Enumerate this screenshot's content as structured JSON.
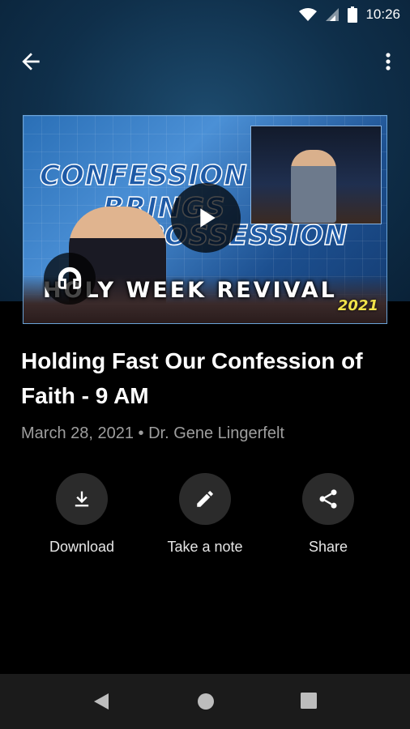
{
  "status_bar": {
    "time": "10:26"
  },
  "video": {
    "thumbnail_text": {
      "line1": "CONFESSION",
      "line2": "BRINGS",
      "line3": "POSSESSION",
      "banner": "HOLY WEEK REVIVAL",
      "year": "2021"
    }
  },
  "sermon": {
    "title": "Holding Fast Our Confession of Faith - 9 AM",
    "meta": "March 28, 2021 • Dr. Gene Lingerfelt"
  },
  "actions": [
    {
      "label": "Download",
      "icon": "download-icon"
    },
    {
      "label": "Take a note",
      "icon": "pencil-icon"
    },
    {
      "label": "Share",
      "icon": "share-icon"
    }
  ],
  "colors": {
    "header_bg": "#0f2f4a",
    "background": "#000000",
    "meta_text": "#9e9e9e",
    "action_circle": "#2b2b2b",
    "nav_bar": "#1b1b1b"
  }
}
